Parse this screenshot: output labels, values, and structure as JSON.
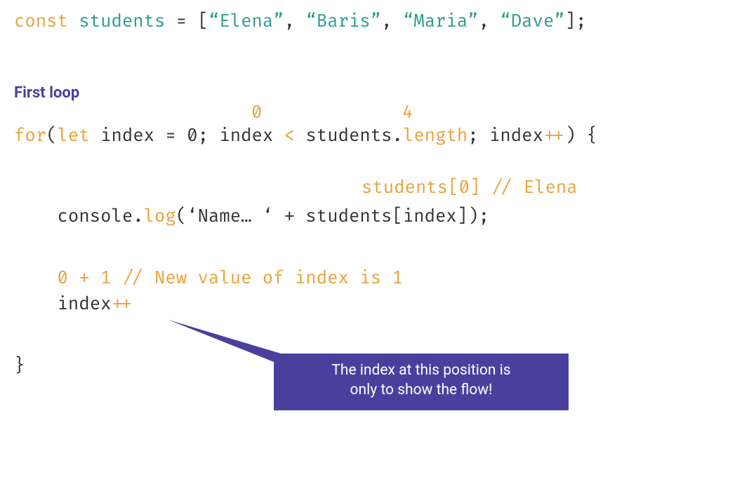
{
  "line1": {
    "kw_const": "const",
    "var_students": "students",
    "eq": " = ",
    "open": "[",
    "s1": "“Elena”",
    "c1": ", ",
    "s2": "“Baris”",
    "c2": ", ",
    "s3": "“Maria”",
    "c3": ", ",
    "s4": "“Dave”",
    "close": "];"
  },
  "heading": "First loop",
  "anno_zero": "0",
  "anno_four": "4",
  "for_line": {
    "kw_for": "for",
    "open_paren": "(",
    "kw_let": "let",
    "sp1": " ",
    "index1": "index",
    "eq": " = ",
    "zero": "0",
    "semi1": "; ",
    "index2": "index",
    "sp2": " ",
    "lt": "<",
    "sp3": " ",
    "students": "students",
    "dot": ".",
    "length": "length",
    "semi2": "; ",
    "index3": "index",
    "pp": "++",
    "close_paren": ") {"
  },
  "students_anno": "students[0] // Elena",
  "console_line": {
    "indent": "    ",
    "console": "console",
    "dot": ".",
    "log": "log",
    "open": "(",
    "str": "‘Name… ‘",
    "plus": " + ",
    "students": "students",
    "br_open": "[",
    "index": "index",
    "br_close": "]",
    "close": ");"
  },
  "new_value_comment": "0 + 1 // New value of index is 1",
  "indexpp_line": {
    "indent": "    ",
    "index": "index",
    "pp": "++"
  },
  "close_brace": "}",
  "callout_l1": "The index at this position is",
  "callout_l2": "only to show the flow!"
}
